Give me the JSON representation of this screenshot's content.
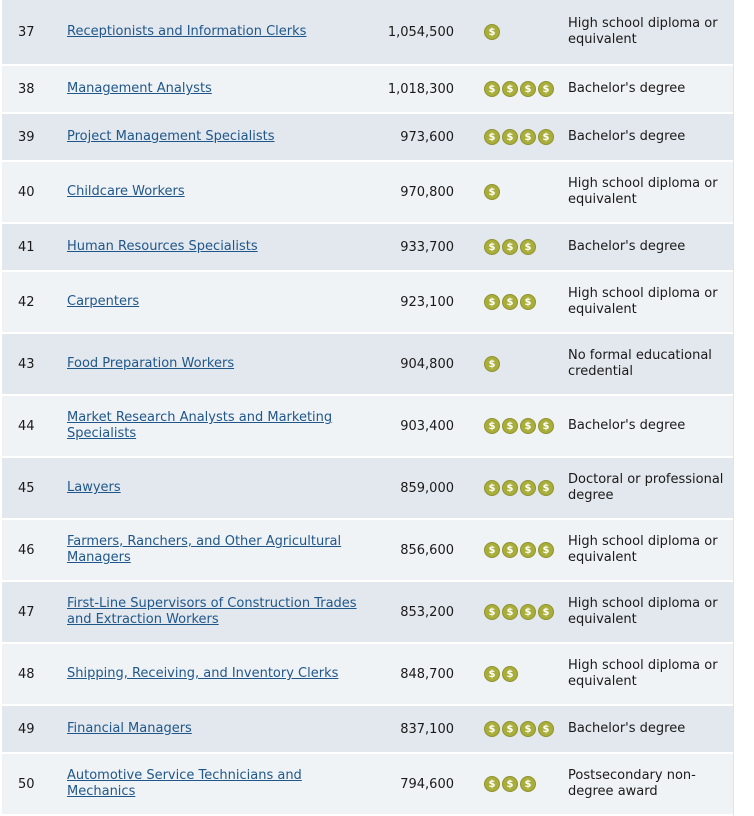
{
  "rows": [
    {
      "rank": "37",
      "title": "Receptionists and Information Clerks",
      "employment": "1,054,500",
      "pay_level": 1,
      "education": "High school diploma or equivalent",
      "height": 66
    },
    {
      "rank": "38",
      "title": "Management Analysts",
      "employment": "1,018,300",
      "pay_level": 4,
      "education": "Bachelor's degree",
      "height": 48
    },
    {
      "rank": "39",
      "title": "Project Management Specialists",
      "employment": "973,600",
      "pay_level": 4,
      "education": "Bachelor's degree",
      "height": 48
    },
    {
      "rank": "40",
      "title": "Childcare Workers",
      "employment": "970,800",
      "pay_level": 1,
      "education": "High school diploma or equivalent",
      "height": 62
    },
    {
      "rank": "41",
      "title": "Human Resources Specialists",
      "employment": "933,700",
      "pay_level": 3,
      "education": "Bachelor's degree",
      "height": 48
    },
    {
      "rank": "42",
      "title": "Carpenters",
      "employment": "923,100",
      "pay_level": 3,
      "education": "High school diploma or equivalent",
      "height": 62
    },
    {
      "rank": "43",
      "title": "Food Preparation Workers",
      "employment": "904,800",
      "pay_level": 1,
      "education": "No formal educational credential",
      "height": 62
    },
    {
      "rank": "44",
      "title": "Market Research Analysts and Marketing Specialists",
      "employment": "903,400",
      "pay_level": 4,
      "education": "Bachelor's degree",
      "height": 62
    },
    {
      "rank": "45",
      "title": "Lawyers",
      "employment": "859,000",
      "pay_level": 4,
      "education": "Doctoral or professional degree",
      "height": 62
    },
    {
      "rank": "46",
      "title": "Farmers, Ranchers, and Other Agricultural Managers",
      "employment": "856,600",
      "pay_level": 4,
      "education": "High school diploma or equivalent",
      "height": 62
    },
    {
      "rank": "47",
      "title": "First-Line Supervisors of Construction Trades and Extraction Workers",
      "employment": "853,200",
      "pay_level": 4,
      "education": "High school diploma or equivalent",
      "height": 62
    },
    {
      "rank": "48",
      "title": "Shipping, Receiving, and Inventory Clerks",
      "employment": "848,700",
      "pay_level": 2,
      "education": "High school diploma or equivalent",
      "height": 62
    },
    {
      "rank": "49",
      "title": "Financial Managers",
      "employment": "837,100",
      "pay_level": 4,
      "education": "Bachelor's degree",
      "height": 48
    },
    {
      "rank": "50",
      "title": "Automotive Service Technicians and Mechanics",
      "employment": "794,600",
      "pay_level": 3,
      "education": "Postsecondary non-degree award",
      "height": 62
    }
  ],
  "coin_symbol": "$",
  "colors": {
    "coin": "#a9ad3a",
    "link": "#20578a",
    "row_odd": "#e3e8ee",
    "row_even": "#f0f3f6"
  }
}
